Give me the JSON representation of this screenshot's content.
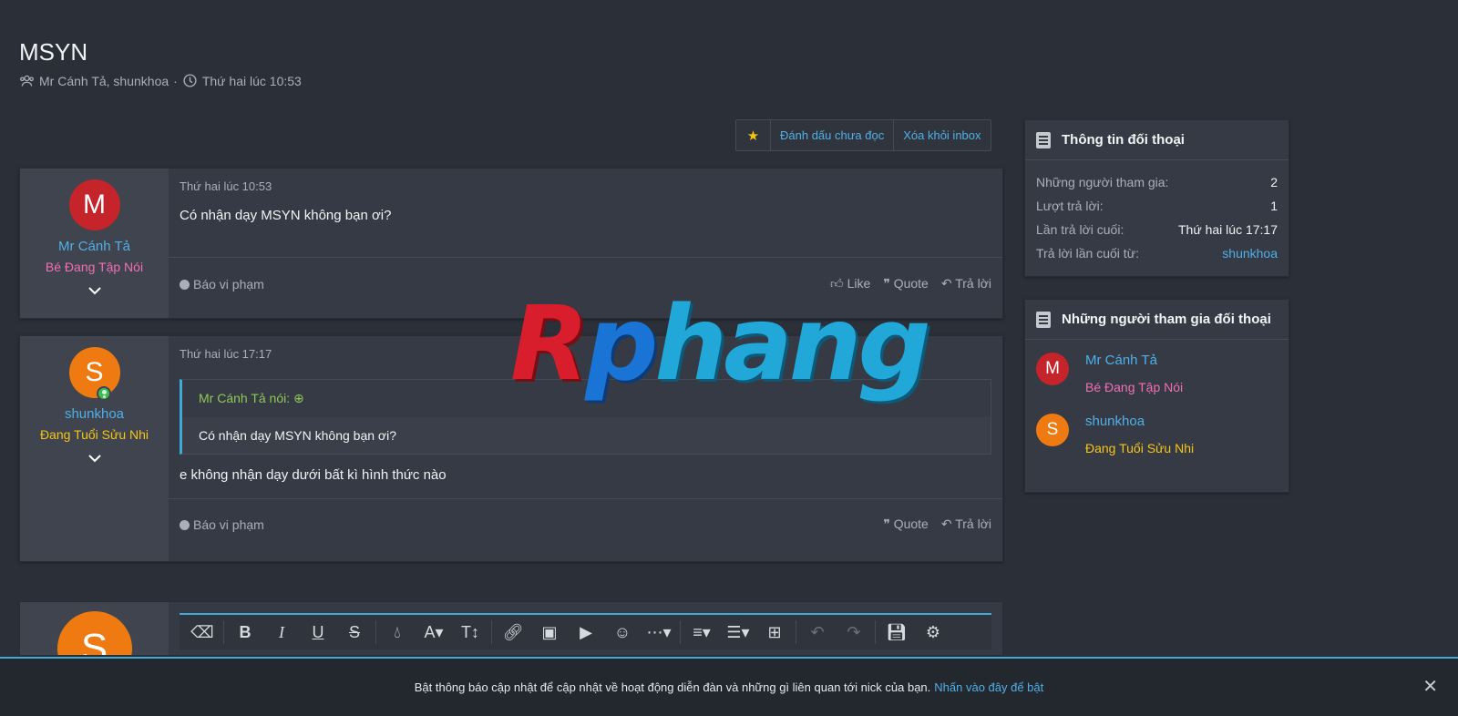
{
  "thread": {
    "title": "MSYN",
    "participants_line": "Mr Cánh Tả, shunkhoa",
    "date": "Thứ hai lúc 10:53"
  },
  "actions": {
    "mark_unread": "Đánh dấu chưa đọc",
    "remove_inbox": "Xóa khỏi inbox"
  },
  "messages": [
    {
      "avatar_letter": "M",
      "username": "Mr Cánh Tả",
      "user_title": "Bé Đang Tập Nói",
      "date": "Thứ hai lúc 10:53",
      "body": "Có nhận dạy MSYN không bạn ơi?",
      "report": "Báo vi phạm",
      "like": "Like",
      "quote": "Quote",
      "reply": "Trả lời"
    },
    {
      "avatar_letter": "S",
      "username": "shunkhoa",
      "user_title": "Đang Tuổi Sửu Nhi",
      "date": "Thứ hai lúc 17:17",
      "quote_author": "Mr Cánh Tả nói:",
      "quote_body": "Có nhận dạy MSYN không bạn ơi?",
      "body": "e không nhận dạy dưới bất kì hình thức nào",
      "report": "Báo vi phạm",
      "quote": "Quote",
      "reply": "Trả lời"
    }
  ],
  "editor": {
    "avatar_letter": "S"
  },
  "sidebar": {
    "info": {
      "title": "Thông tin đối thoại",
      "rows": [
        {
          "key": "Những người tham gia:",
          "value": "2"
        },
        {
          "key": "Lượt trả lời:",
          "value": "1"
        },
        {
          "key": "Lần trả lời cuối:",
          "value": "Thứ hai lúc 17:17"
        },
        {
          "key": "Trả lời lần cuối từ:",
          "value": "shunkhoa"
        }
      ]
    },
    "participants": {
      "title": "Những người tham gia đối thoại",
      "people": [
        {
          "letter": "M",
          "name": "Mr Cánh Tả",
          "title": "Bé Đang Tập Nói"
        },
        {
          "letter": "S",
          "name": "shunkhoa",
          "title": "Đang Tuổi Sửu Nhi"
        }
      ]
    }
  },
  "watermark": "Rphang",
  "notice": {
    "text": "Bật thông báo cập nhật để cập nhật về hoạt động diễn đàn và những gì liên quan tới nick của bạn.",
    "link": "Nhấn vào đây để bật"
  },
  "colors": {
    "background": "#2b2f38",
    "link": "#4fb0e8",
    "accent": "#3fa9d8",
    "title_pink": "#f06fb6",
    "title_gold": "#f5c518"
  }
}
